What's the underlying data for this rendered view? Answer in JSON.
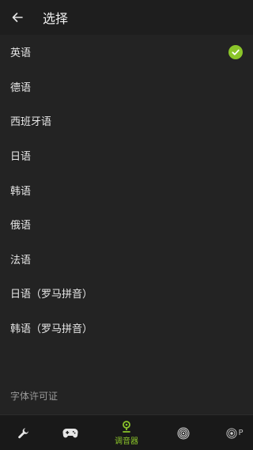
{
  "header": {
    "title": "选择"
  },
  "languages": [
    {
      "label": "英语",
      "selected": true
    },
    {
      "label": "德语",
      "selected": false
    },
    {
      "label": "西班牙语",
      "selected": false
    },
    {
      "label": "日语",
      "selected": false
    },
    {
      "label": "韩语",
      "selected": false
    },
    {
      "label": "俄语",
      "selected": false
    },
    {
      "label": "法语",
      "selected": false
    },
    {
      "label": "日语（罗马拼音）",
      "selected": false
    },
    {
      "label": "韩语（罗马拼音）",
      "selected": false
    }
  ],
  "license_label": "字体许可证",
  "bottom_nav": {
    "tuner_label": "调音器",
    "partial_label": "P"
  },
  "colors": {
    "accent": "#8bc52a",
    "background": "#232323",
    "header": "#1e1e1e",
    "nav": "#191919"
  }
}
